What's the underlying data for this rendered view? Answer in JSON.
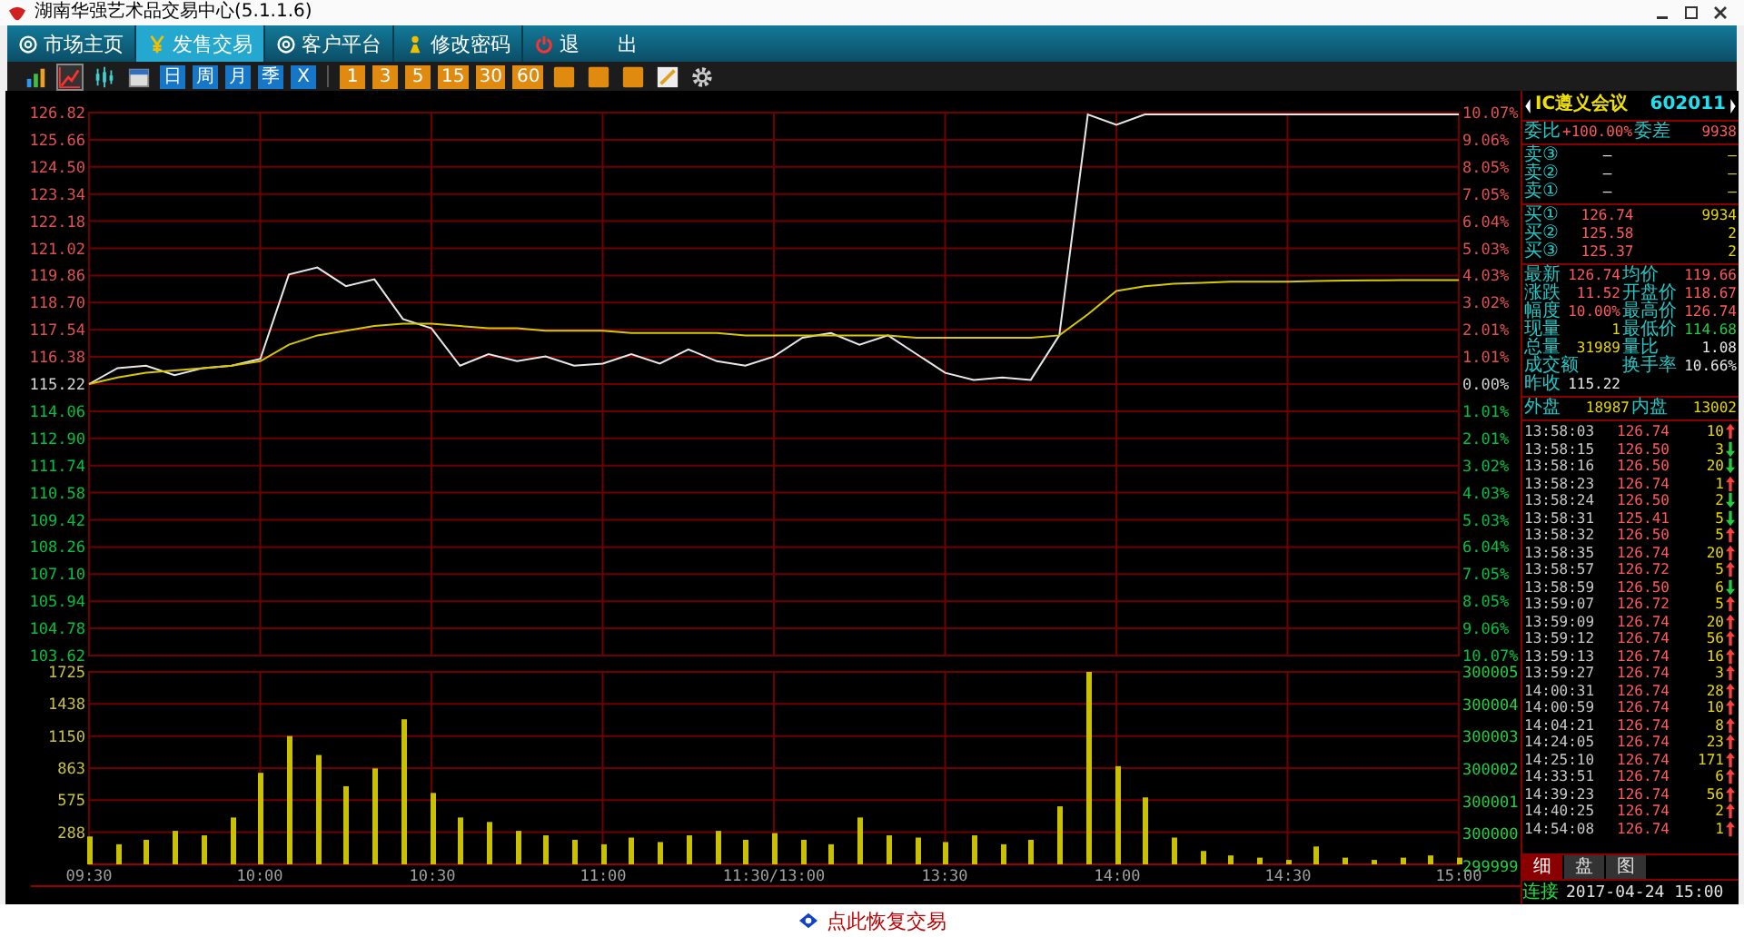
{
  "window": {
    "title": "湖南华强艺术品交易中心(5.1.1.6)"
  },
  "menu": [
    {
      "label": "市场主页",
      "selected": false
    },
    {
      "label": "发售交易",
      "selected": true
    },
    {
      "label": "客户平台",
      "selected": false
    },
    {
      "label": "修改密码",
      "selected": false
    },
    {
      "label": "退      出",
      "selected": false
    }
  ],
  "toolbar": [
    {
      "kind": "bars",
      "selected": false
    },
    {
      "kind": "line",
      "selected": true
    },
    {
      "kind": "candles",
      "selected": false
    },
    {
      "kind": "calendar",
      "selected": false
    },
    {
      "kind": "day",
      "label": "日",
      "selected": false
    },
    {
      "kind": "day",
      "label": "周",
      "selected": false
    },
    {
      "kind": "day",
      "label": "月",
      "selected": false
    },
    {
      "kind": "day",
      "label": "季",
      "selected": false
    },
    {
      "kind": "day",
      "label": "X",
      "selected": false
    },
    {
      "kind": "minute",
      "label": "1",
      "selected": false
    },
    {
      "kind": "minute",
      "label": "3",
      "selected": false
    },
    {
      "kind": "minute",
      "label": "5",
      "selected": false
    },
    {
      "kind": "minute",
      "label": "15",
      "selected": false
    },
    {
      "kind": "minute",
      "label": "30",
      "selected": false
    },
    {
      "kind": "minute",
      "label": "60",
      "selected": false
    },
    {
      "kind": "blank",
      "selected": false
    },
    {
      "kind": "blank",
      "selected": false
    },
    {
      "kind": "blank",
      "selected": false
    },
    {
      "kind": "pencil",
      "selected": false
    },
    {
      "kind": "gear",
      "selected": false
    }
  ],
  "price_chart": {
    "chart_data": {
      "type": "line",
      "grid": true,
      "series": [
        {
          "color": "#e8e8e8",
          "values": [
            115.22,
            115.9,
            116.0,
            115.6,
            115.9,
            116.0,
            116.3,
            119.9,
            120.2,
            119.4,
            119.7,
            118.0,
            117.6,
            116.0,
            116.5,
            116.2,
            116.4,
            116.0,
            116.1,
            116.5,
            116.1,
            116.7,
            116.2,
            116.0,
            116.4,
            117.2,
            117.4,
            116.9,
            117.3,
            116.5,
            115.7,
            115.4,
            115.5,
            115.4,
            117.3,
            126.74,
            126.3,
            126.74,
            126.74,
            126.74,
            126.74,
            126.74,
            126.74,
            126.74,
            126.74,
            126.74,
            126.74,
            126.74,
            126.74
          ]
        },
        {
          "color": "#d8c800",
          "values": [
            115.22,
            115.5,
            115.7,
            115.8,
            115.9,
            116.0,
            116.2,
            116.9,
            117.3,
            117.5,
            117.7,
            117.8,
            117.8,
            117.7,
            117.6,
            117.6,
            117.5,
            117.5,
            117.5,
            117.4,
            117.4,
            117.4,
            117.4,
            117.3,
            117.3,
            117.3,
            117.3,
            117.3,
            117.3,
            117.2,
            117.2,
            117.2,
            117.2,
            117.2,
            117.3,
            118.2,
            119.2,
            119.4,
            119.5,
            119.55,
            119.6,
            119.6,
            119.6,
            119.62,
            119.64,
            119.65,
            119.66,
            119.66,
            119.66
          ]
        }
      ],
      "ylim": [
        103.62,
        126.82
      ],
      "yticks": [
        {
          "value": 126.82,
          "label": "126.82"
        },
        {
          "value": 125.66,
          "label": "125.66"
        },
        {
          "value": 124.5,
          "label": "124.50"
        },
        {
          "value": 123.34,
          "label": "123.34"
        },
        {
          "value": 122.18,
          "label": "122.18"
        },
        {
          "value": 121.02,
          "label": "121.02"
        },
        {
          "value": 119.86,
          "label": "119.86"
        },
        {
          "value": 118.7,
          "label": "118.70"
        },
        {
          "value": 117.54,
          "label": "117.54"
        },
        {
          "value": 116.38,
          "label": "116.38"
        },
        {
          "value": 115.22,
          "label": "115.22"
        },
        {
          "value": 114.06,
          "label": "114.06"
        },
        {
          "value": 112.9,
          "label": "112.90"
        },
        {
          "value": 111.74,
          "label": "111.74"
        },
        {
          "value": 110.58,
          "label": "110.58"
        },
        {
          "value": 109.42,
          "label": "109.42"
        },
        {
          "value": 108.26,
          "label": "108.26"
        },
        {
          "value": 107.1,
          "label": "107.10"
        },
        {
          "value": 105.94,
          "label": "105.94"
        },
        {
          "value": 104.78,
          "label": "104.78"
        },
        {
          "value": 103.62,
          "label": "103.62"
        }
      ]
    },
    "percent_ticks": [
      "10.07%",
      "9.06%",
      "8.05%",
      "7.05%",
      "6.04%",
      "5.03%",
      "4.03%",
      "3.02%",
      "2.01%",
      "1.01%",
      "0.00%",
      "1.01%",
      "2.01%",
      "3.02%",
      "4.03%",
      "5.03%",
      "6.04%",
      "7.05%",
      "8.05%",
      "9.06%",
      "10.07%"
    ]
  },
  "volume_chart": {
    "chart_data": {
      "type": "bar",
      "grid": true,
      "categories": [
        "09:30",
        null,
        null,
        null,
        null,
        null,
        "10:00",
        null,
        null,
        null,
        null,
        null,
        "10:30",
        null,
        null,
        null,
        null,
        null,
        "11:00",
        null,
        null,
        null,
        null,
        null,
        "11:30/13:00",
        null,
        null,
        null,
        null,
        null,
        "13:30",
        null,
        null,
        null,
        null,
        null,
        "14:00",
        null,
        null,
        null,
        null,
        null,
        "14:30",
        null,
        null,
        null,
        null,
        null,
        "15:00"
      ],
      "values": [
        250,
        180,
        220,
        300,
        260,
        420,
        820,
        1150,
        980,
        700,
        860,
        1300,
        640,
        420,
        380,
        300,
        260,
        220,
        180,
        240,
        200,
        260,
        300,
        220,
        280,
        220,
        180,
        420,
        260,
        240,
        200,
        260,
        180,
        220,
        520,
        1725,
        880,
        600,
        240,
        120,
        80,
        60,
        40,
        160,
        60,
        40,
        60,
        80,
        60
      ],
      "ylim": [
        0,
        1725
      ],
      "yticks": [
        {
          "value": 1725,
          "label": "1725"
        },
        {
          "value": 1438,
          "label": "1438"
        },
        {
          "value": 1150,
          "label": "1150"
        },
        {
          "value": 863,
          "label": "863"
        },
        {
          "value": 575,
          "label": "575"
        },
        {
          "value": 288,
          "label": "288"
        }
      ]
    },
    "right_ticks": [
      "300005",
      "300004",
      "300003",
      "300002",
      "300001",
      "300000",
      "299999"
    ]
  },
  "quote_panel": {
    "name": "IC遵义会议",
    "code": "602011",
    "ratio": {
      "label": "委比",
      "value": "+100.00%",
      "diff_label": "委差",
      "diff": "9938"
    },
    "asks": [
      {
        "label": "卖③",
        "price": "—",
        "volume": "—"
      },
      {
        "label": "卖②",
        "price": "—",
        "volume": "—"
      },
      {
        "label": "卖①",
        "price": "—",
        "volume": "—"
      }
    ],
    "bids": [
      {
        "label": "买①",
        "price": "126.74",
        "volume": "9934"
      },
      {
        "label": "买②",
        "price": "125.58",
        "volume": "2"
      },
      {
        "label": "买③",
        "price": "125.37",
        "volume": "2"
      }
    ],
    "stats": [
      {
        "label": "最新",
        "value": "126.74",
        "color": "#ff5a5a"
      },
      {
        "label": "均价",
        "value": "119.66",
        "color": "#ff5a5a"
      },
      {
        "label": "涨跌",
        "value": "11.52",
        "color": "#ff5a5a"
      },
      {
        "label": "开盘价",
        "value": "118.67",
        "color": "#ff5a5a"
      },
      {
        "label": "幅度",
        "value": "10.00%",
        "color": "#ff5a5a"
      },
      {
        "label": "最高价",
        "value": "126.74",
        "color": "#ff5a5a"
      },
      {
        "label": "现量",
        "value": "1",
        "color": "#e8d800"
      },
      {
        "label": "最低价",
        "value": "114.68",
        "color": "#20d040"
      },
      {
        "label": "总量",
        "value": "31989",
        "color": "#e8d800"
      },
      {
        "label": "量比",
        "value": "1.08",
        "color": "#e8e8e8"
      },
      {
        "label": "成交额"
      },
      {
        "label": "换手率",
        "value": "10.66%",
        "color": "#e8e8e8"
      },
      {
        "label": "昨收",
        "value": "115.22",
        "color": "#e8e8e8"
      }
    ],
    "outer": {
      "label": "外盘",
      "value": "18987",
      "label2": "内盘",
      "value2": "13002"
    },
    "ticks": [
      {
        "time": "13:58:03",
        "price": "126.74",
        "volume": "10",
        "up": true
      },
      {
        "time": "13:58:15",
        "price": "126.50",
        "volume": "3",
        "up": false
      },
      {
        "time": "13:58:16",
        "price": "126.50",
        "volume": "20",
        "up": false
      },
      {
        "time": "13:58:23",
        "price": "126.74",
        "volume": "1",
        "up": true
      },
      {
        "time": "13:58:24",
        "price": "126.50",
        "volume": "2",
        "up": false
      },
      {
        "time": "13:58:31",
        "price": "125.41",
        "volume": "5",
        "up": false
      },
      {
        "time": "13:58:32",
        "price": "126.50",
        "volume": "5",
        "up": true
      },
      {
        "time": "13:58:35",
        "price": "126.74",
        "volume": "20",
        "up": true
      },
      {
        "time": "13:58:57",
        "price": "126.72",
        "volume": "5",
        "up": true
      },
      {
        "time": "13:58:59",
        "price": "126.50",
        "volume": "6",
        "up": false
      },
      {
        "time": "13:59:07",
        "price": "126.72",
        "volume": "5",
        "up": true
      },
      {
        "time": "13:59:09",
        "price": "126.74",
        "volume": "20",
        "up": true
      },
      {
        "time": "13:59:12",
        "price": "126.74",
        "volume": "56",
        "up": true
      },
      {
        "time": "13:59:13",
        "price": "126.74",
        "volume": "16",
        "up": true
      },
      {
        "time": "13:59:27",
        "price": "126.74",
        "volume": "3",
        "up": true
      },
      {
        "time": "14:00:31",
        "price": "126.74",
        "volume": "28",
        "up": true
      },
      {
        "time": "14:00:59",
        "price": "126.74",
        "volume": "10",
        "up": true
      },
      {
        "time": "14:04:21",
        "price": "126.74",
        "volume": "8",
        "up": true
      },
      {
        "time": "14:24:05",
        "price": "126.74",
        "volume": "23",
        "up": true
      },
      {
        "time": "14:25:10",
        "price": "126.74",
        "volume": "171",
        "up": true
      },
      {
        "time": "14:33:51",
        "price": "126.74",
        "volume": "6",
        "up": true
      },
      {
        "time": "14:39:23",
        "price": "126.74",
        "volume": "56",
        "up": true
      },
      {
        "time": "14:40:25",
        "price": "126.74",
        "volume": "2",
        "up": true
      },
      {
        "time": "14:54:08",
        "price": "126.74",
        "volume": "1",
        "up": true
      }
    ],
    "tabs": [
      {
        "label": "细",
        "selected": true
      },
      {
        "label": "盘",
        "selected": false
      },
      {
        "label": "图",
        "selected": false
      }
    ]
  },
  "status_bar": {
    "connection": "连接",
    "datetime": "2017-04-24 15:00"
  },
  "footer": {
    "action": "点此恢复交易"
  }
}
